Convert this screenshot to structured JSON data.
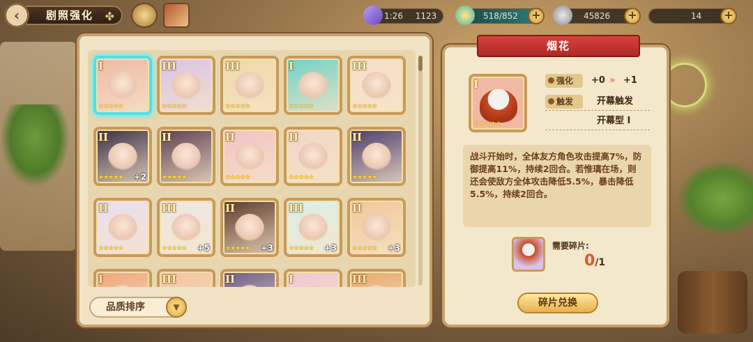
{
  "header": {
    "title": "剧照强化",
    "stamina": "1123",
    "stamina_timer": "1:26",
    "energy": "518/852",
    "coins": "45826",
    "status": "14"
  },
  "colors": {
    "ribbon": "#c0322d",
    "selected_glow": "#4fe0ea",
    "gold_button": "#e8b04c",
    "fragment_count": "#e1582c"
  },
  "cards": [
    {
      "roman": "I",
      "stars": "★★★★★",
      "plus": "",
      "selected": true,
      "bg": "#f0b9a3"
    },
    {
      "roman": "III",
      "stars": "★★★★★",
      "plus": "",
      "selected": false,
      "bg": "#d9c3e8"
    },
    {
      "roman": "III",
      "stars": "★★★★★",
      "plus": "",
      "selected": false,
      "bg": "#eed9a6"
    },
    {
      "roman": "I",
      "stars": "★★★★★",
      "plus": "",
      "selected": false,
      "bg": "#6fd2c7"
    },
    {
      "roman": "III",
      "stars": "★★★★★",
      "plus": "",
      "selected": false,
      "bg": "#f5e0c9"
    },
    {
      "roman": "II",
      "stars": "★★★★★",
      "plus": "+2",
      "selected": false,
      "bg": "#3a2f45"
    },
    {
      "roman": "II",
      "stars": "★★★★★",
      "plus": "",
      "selected": false,
      "bg": "#5a3f52"
    },
    {
      "roman": "II",
      "stars": "★★★★★",
      "plus": "",
      "selected": false,
      "bg": "#f3c2c6"
    },
    {
      "roman": "II",
      "stars": "★★★★★",
      "plus": "",
      "selected": false,
      "bg": "#f0d6c8"
    },
    {
      "roman": "II",
      "stars": "★★★★★",
      "plus": "",
      "selected": false,
      "bg": "#4b3c6b"
    },
    {
      "roman": "II",
      "stars": "★★★★★",
      "plus": "",
      "selected": false,
      "bg": "#e8dff0"
    },
    {
      "roman": "III",
      "stars": "★★★★★",
      "plus": "+5",
      "selected": false,
      "bg": "#ece8e4"
    },
    {
      "roman": "II",
      "stars": "★★★★★",
      "plus": "+3",
      "selected": false,
      "bg": "#5a3a2a"
    },
    {
      "roman": "III",
      "stars": "★★★★★",
      "plus": "+3",
      "selected": false,
      "bg": "#d9efe6"
    },
    {
      "roman": "II",
      "stars": "★★★★★",
      "plus": "+3",
      "selected": false,
      "bg": "#f2c79a"
    },
    {
      "roman": "I",
      "stars": "",
      "plus": "",
      "selected": false,
      "bg": "#f0a57a"
    },
    {
      "roman": "III",
      "stars": "",
      "plus": "",
      "selected": false,
      "bg": "#f2c2a0"
    },
    {
      "roman": "II",
      "stars": "",
      "plus": "",
      "selected": false,
      "bg": "#6a5a8a"
    },
    {
      "roman": "I",
      "stars": "",
      "plus": "",
      "selected": false,
      "bg": "#f2c6d6"
    },
    {
      "roman": "III",
      "stars": "",
      "plus": "",
      "selected": false,
      "bg": "#e9a86a"
    }
  ],
  "sort": {
    "label": "品质排序"
  },
  "detail": {
    "name": "烟花",
    "roman": "I",
    "stars": "★★★★★",
    "enhance_label": "强化",
    "enhance_from": "+0",
    "enhance_to": "+1",
    "trigger_label": "触发",
    "trigger_value": "开幕触发",
    "type_value": "开幕型 I",
    "description": "战斗开始时，全体友方角色攻击提高7%，防御提高11%，持续2回合。若惟璃在场，则还会使敌方全体攻击降低5.5%，暴击降低5.5%，持续2回合。",
    "fragments_label": "需要碎片:",
    "fragments_have": "0",
    "fragments_need": "/1",
    "exchange_button": "碎片兑换"
  }
}
